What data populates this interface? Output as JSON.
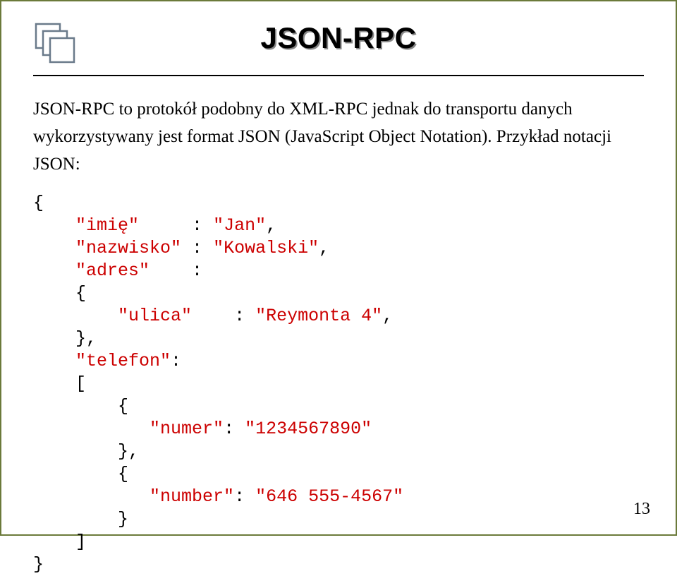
{
  "header": {
    "title": "JSON-RPC"
  },
  "body": {
    "paragraph": "JSON-RPC to protokół podobny do XML-RPC jednak do transportu danych wykorzystywany jest format JSON (JavaScript Object Notation). Przykład notacji JSON:"
  },
  "code": {
    "l1": "{",
    "l2a": "    ",
    "l2b": "\"imię\"",
    "l2c": "     : ",
    "l2d": "\"Jan\"",
    "l2e": ",",
    "l3a": "    ",
    "l3b": "\"nazwisko\"",
    "l3c": " : ",
    "l3d": "\"Kowalski\"",
    "l3e": ",",
    "l4a": "    ",
    "l4b": "\"adres\"",
    "l4c": "    : ",
    "l5": "    {",
    "l6a": "        ",
    "l6b": "\"ulica\"",
    "l6c": "    : ",
    "l6d": "\"Reymonta 4\"",
    "l6e": ",",
    "l7": "    },",
    "l8a": "    ",
    "l8b": "\"telefon\"",
    "l8c": ":",
    "l9": "    [",
    "l10": "        {",
    "l11a": "           ",
    "l11b": "\"numer\"",
    "l11c": ": ",
    "l11d": "\"1234567890\"",
    "l12": "        },",
    "l13": "        {",
    "l14a": "           ",
    "l14b": "\"number\"",
    "l14c": ": ",
    "l14d": "\"646 555-4567\"",
    "l15": "        }",
    "l16": "    ]",
    "l17": "}"
  },
  "page_number": "13"
}
